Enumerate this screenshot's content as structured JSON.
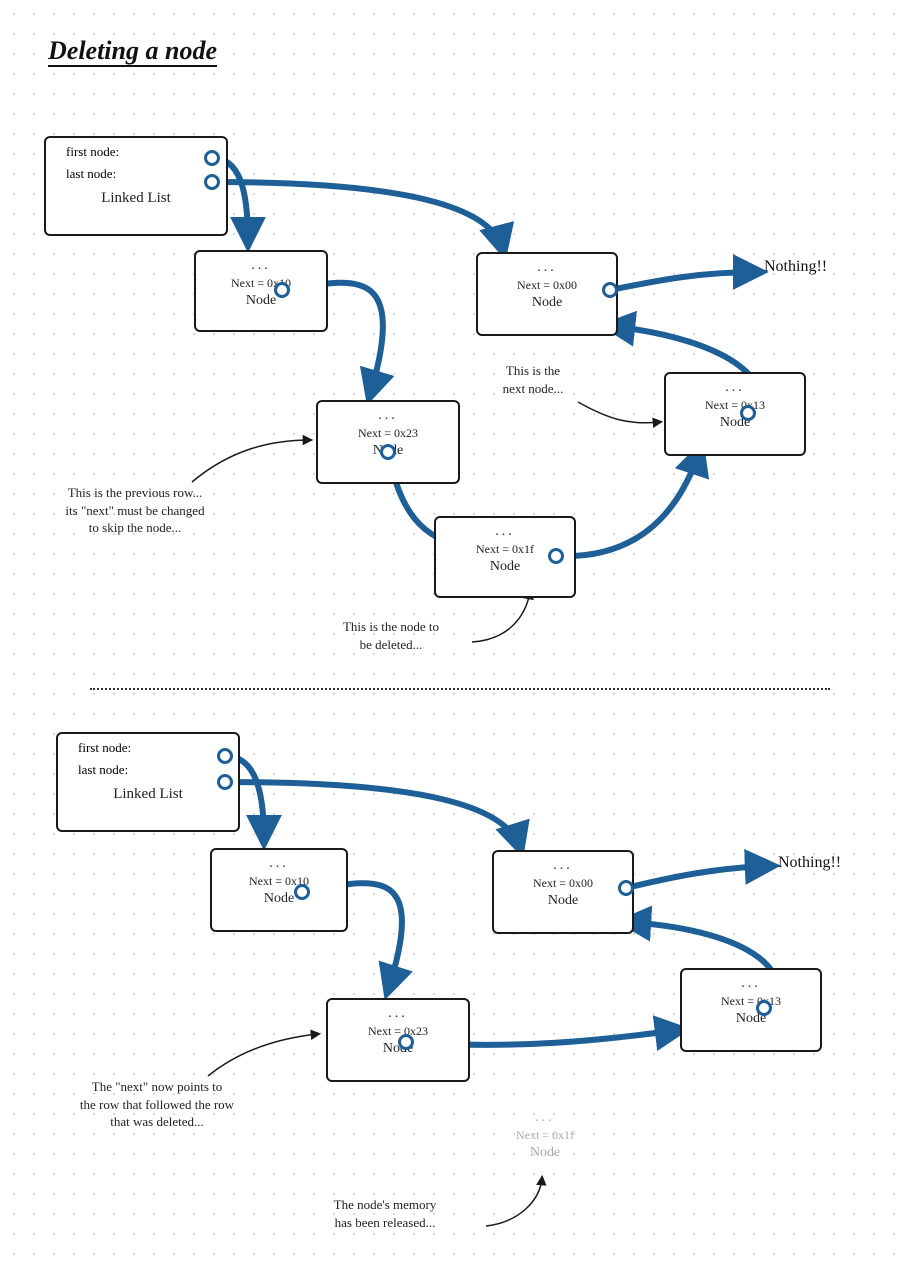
{
  "title": "Deleting a node",
  "linkedList": {
    "first": "first node:",
    "last": "last node:",
    "label": "Linked List"
  },
  "nodeDots": "...",
  "nodeLabel": "Node",
  "p1": {
    "n1_next": "Next = 0x10",
    "n2_next": "Next = 0x00",
    "n3_next": "Next = 0x23",
    "n4_next": "Next = 0x1f",
    "n5_next": "Next = 0x13",
    "nothing": "Nothing!!",
    "ann_prev": "This is the previous row...\nits \"next\" must be changed\nto skip the node...",
    "ann_next": "This is the\nnext node...",
    "ann_del": "This is the node to\nbe deleted..."
  },
  "p2": {
    "n1_next": "Next = 0x10",
    "n2_next": "Next = 0x00",
    "n3_next": "Next = 0x23",
    "n5_next": "Next = 0x13",
    "ghost_next": "Next = 0x1f",
    "nothing": "Nothing!!",
    "ann_now": "The \"next\" now points to\nthe row that followed the row\nthat was deleted...",
    "ann_rel": "The node's memory\nhas been released..."
  },
  "colors": {
    "arrow": "#1d5f96",
    "ink": "#1a1a1a"
  }
}
